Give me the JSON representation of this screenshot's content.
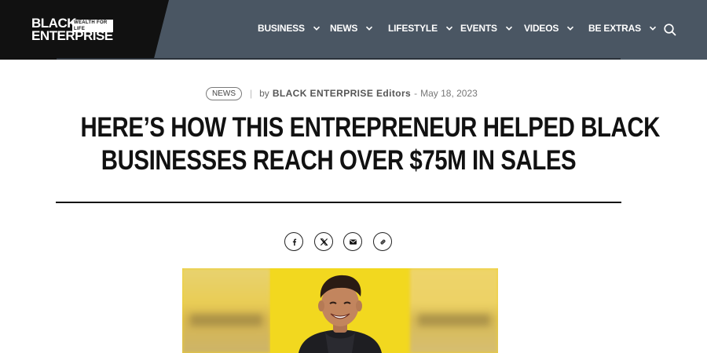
{
  "header": {
    "logo": {
      "line1": "BLACK",
      "line2": "ENTERPRISE",
      "tagline": "WEALTH FOR LIFE"
    },
    "nav": [
      {
        "label": "BUSINESS"
      },
      {
        "label": "NEWS"
      },
      {
        "label": "LIFESTYLE"
      },
      {
        "label": "EVENTS"
      },
      {
        "label": "VIDEOS"
      },
      {
        "label": "BE EXTRAS"
      }
    ],
    "search_icon": "search-icon"
  },
  "article": {
    "category": "NEWS",
    "byline_prefix": "by",
    "author": "BLACK ENTERPRISE Editors",
    "date_separator": "-",
    "date": "May 18, 2023",
    "title_lines": [
      "HERE’S HOW THIS ENTREPRENEUR HELPED BLACK",
      "BUSINESSES REACH OVER $75M IN SALES"
    ]
  },
  "share": [
    {
      "icon": "facebook-icon"
    },
    {
      "icon": "x-twitter-icon"
    },
    {
      "icon": "email-icon"
    },
    {
      "icon": "copy-link-icon"
    }
  ],
  "colors": {
    "header_bg": "#4a5663",
    "logo_bg": "#111111",
    "hero_bg": "#f2d81f",
    "text": "#111111"
  }
}
